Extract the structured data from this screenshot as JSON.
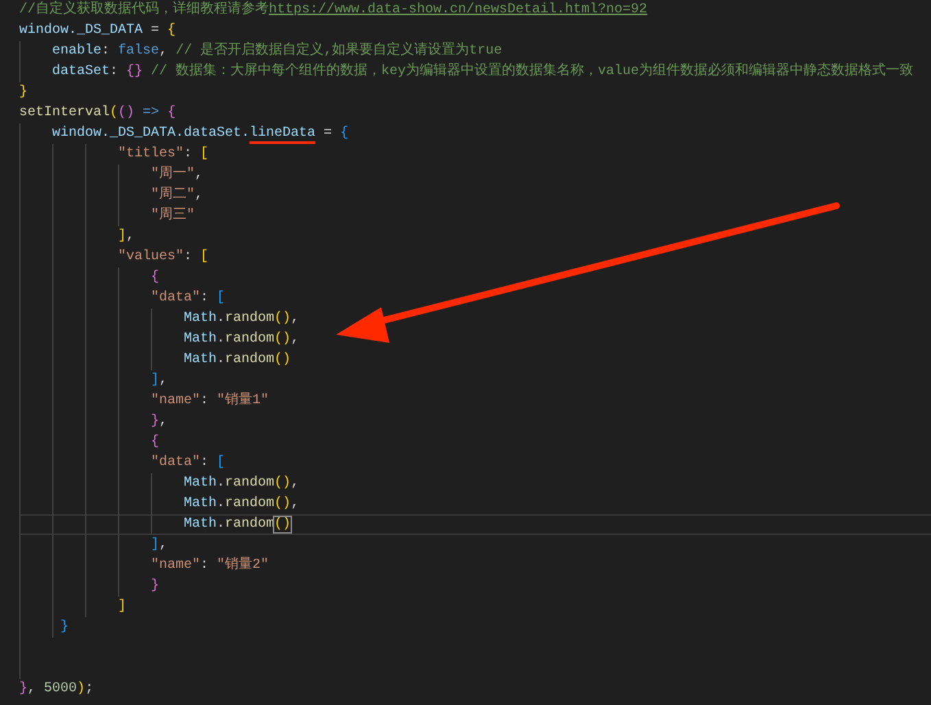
{
  "lines": [
    {
      "kind": "code",
      "tokens": [
        {
          "text": "//自定义获取数据代码，详细教程请参考",
          "kind": "comment"
        },
        {
          "text": "https://www.data-show.cn/newsDetail.html?no=92",
          "kind": "link"
        }
      ]
    },
    {
      "kind": "code",
      "tokens": [
        {
          "text": "window._DS_DATA",
          "kind": "variable"
        },
        {
          "text": " = ",
          "kind": "punct"
        },
        {
          "text": "{",
          "kind": "bracket1"
        }
      ]
    },
    {
      "kind": "code",
      "tokens": [
        {
          "text": "    enable",
          "kind": "variable"
        },
        {
          "text": ": ",
          "kind": "punct"
        },
        {
          "text": "false",
          "kind": "keyword"
        },
        {
          "text": ", ",
          "kind": "punct"
        },
        {
          "text": "// 是否开启数据自定义,如果要自定义请设置为true",
          "kind": "comment"
        }
      ]
    },
    {
      "kind": "code",
      "tokens": [
        {
          "text": "    dataSet",
          "kind": "variable"
        },
        {
          "text": ": ",
          "kind": "punct"
        },
        {
          "text": "{}",
          "kind": "bracket2"
        },
        {
          "text": " // 数据集：大屏中每个组件的数据，key为编辑器中设置的数据集名称，value为组件数据必须和编辑器中静态数据格式一致",
          "kind": "comment"
        }
      ]
    },
    {
      "kind": "code",
      "tokens": [
        {
          "text": "}",
          "kind": "bracket1"
        }
      ]
    },
    {
      "kind": "code",
      "tokens": [
        {
          "text": "setInterval",
          "kind": "function"
        },
        {
          "text": "(",
          "kind": "bracket1"
        },
        {
          "text": "()",
          "kind": "bracket2"
        },
        {
          "text": " => ",
          "kind": "keyword"
        },
        {
          "text": "{",
          "kind": "bracket2"
        }
      ]
    },
    {
      "kind": "code",
      "tokens": [
        {
          "text": "    window._DS_DATA.dataSet.",
          "kind": "variable"
        },
        {
          "text": "lineData",
          "kind": "variable",
          "underlined": true
        },
        {
          "text": " = ",
          "kind": "punct"
        },
        {
          "text": "{",
          "kind": "bracket3"
        }
      ]
    },
    {
      "kind": "code",
      "tokens": [
        {
          "text": "            \"titles\"",
          "kind": "string"
        },
        {
          "text": ": ",
          "kind": "punct"
        },
        {
          "text": "[",
          "kind": "bracket1"
        }
      ]
    },
    {
      "kind": "code",
      "tokens": [
        {
          "text": "                \"周一\"",
          "kind": "string"
        },
        {
          "text": ",",
          "kind": "punct"
        }
      ]
    },
    {
      "kind": "code",
      "tokens": [
        {
          "text": "                \"周二\"",
          "kind": "string"
        },
        {
          "text": ",",
          "kind": "punct"
        }
      ]
    },
    {
      "kind": "code",
      "tokens": [
        {
          "text": "                \"周三\"",
          "kind": "string"
        }
      ]
    },
    {
      "kind": "code",
      "tokens": [
        {
          "text": "            ]",
          "kind": "bracket1"
        },
        {
          "text": ",",
          "kind": "punct"
        }
      ]
    },
    {
      "kind": "code",
      "tokens": [
        {
          "text": "            \"values\"",
          "kind": "string"
        },
        {
          "text": ": ",
          "kind": "punct"
        },
        {
          "text": "[",
          "kind": "bracket1"
        }
      ]
    },
    {
      "kind": "code",
      "tokens": [
        {
          "text": "                {",
          "kind": "bracket2"
        }
      ]
    },
    {
      "kind": "code",
      "tokens": [
        {
          "text": "                \"data\"",
          "kind": "string"
        },
        {
          "text": ": ",
          "kind": "punct"
        },
        {
          "text": "[",
          "kind": "bracket3"
        }
      ]
    },
    {
      "kind": "code",
      "tokens": [
        {
          "text": "                    Math",
          "kind": "variable"
        },
        {
          "text": ".",
          "kind": "punct"
        },
        {
          "text": "random",
          "kind": "function"
        },
        {
          "text": "()",
          "kind": "bracket1"
        },
        {
          "text": ",",
          "kind": "punct"
        }
      ]
    },
    {
      "kind": "code",
      "tokens": [
        {
          "text": "                    Math",
          "kind": "variable"
        },
        {
          "text": ".",
          "kind": "punct"
        },
        {
          "text": "random",
          "kind": "function"
        },
        {
          "text": "()",
          "kind": "bracket1"
        },
        {
          "text": ",",
          "kind": "punct"
        }
      ]
    },
    {
      "kind": "code",
      "tokens": [
        {
          "text": "                    Math",
          "kind": "variable"
        },
        {
          "text": ".",
          "kind": "punct"
        },
        {
          "text": "random",
          "kind": "function"
        },
        {
          "text": "()",
          "kind": "bracket1"
        }
      ]
    },
    {
      "kind": "code",
      "tokens": [
        {
          "text": "                ]",
          "kind": "bracket3"
        },
        {
          "text": ",",
          "kind": "punct"
        }
      ]
    },
    {
      "kind": "code",
      "tokens": [
        {
          "text": "                \"name\"",
          "kind": "string"
        },
        {
          "text": ": ",
          "kind": "punct"
        },
        {
          "text": "\"销量1\"",
          "kind": "string"
        }
      ]
    },
    {
      "kind": "code",
      "tokens": [
        {
          "text": "                }",
          "kind": "bracket2"
        },
        {
          "text": ",",
          "kind": "punct"
        }
      ]
    },
    {
      "kind": "code",
      "tokens": [
        {
          "text": "                {",
          "kind": "bracket2"
        }
      ]
    },
    {
      "kind": "code",
      "tokens": [
        {
          "text": "                \"data\"",
          "kind": "string"
        },
        {
          "text": ": ",
          "kind": "punct"
        },
        {
          "text": "[",
          "kind": "bracket3"
        }
      ]
    },
    {
      "kind": "code",
      "tokens": [
        {
          "text": "                    Math",
          "kind": "variable"
        },
        {
          "text": ".",
          "kind": "punct"
        },
        {
          "text": "random",
          "kind": "function"
        },
        {
          "text": "()",
          "kind": "bracket1"
        },
        {
          "text": ",",
          "kind": "punct"
        }
      ]
    },
    {
      "kind": "code",
      "tokens": [
        {
          "text": "                    Math",
          "kind": "variable"
        },
        {
          "text": ".",
          "kind": "punct"
        },
        {
          "text": "random",
          "kind": "function"
        },
        {
          "text": "()",
          "kind": "bracket1"
        },
        {
          "text": ",",
          "kind": "punct"
        }
      ]
    },
    {
      "kind": "code",
      "current": true,
      "tokens": [
        {
          "text": "                    Math",
          "kind": "variable"
        },
        {
          "text": ".",
          "kind": "punct"
        },
        {
          "text": "random",
          "kind": "function"
        },
        {
          "text": "()",
          "kind": "bracket1",
          "matched": true
        }
      ]
    },
    {
      "kind": "code",
      "tokens": [
        {
          "text": "                ]",
          "kind": "bracket3"
        },
        {
          "text": ",",
          "kind": "punct"
        }
      ]
    },
    {
      "kind": "code",
      "tokens": [
        {
          "text": "                \"name\"",
          "kind": "string"
        },
        {
          "text": ": ",
          "kind": "punct"
        },
        {
          "text": "\"销量2\"",
          "kind": "string"
        }
      ]
    },
    {
      "kind": "code",
      "tokens": [
        {
          "text": "                }",
          "kind": "bracket2"
        }
      ]
    },
    {
      "kind": "code",
      "tokens": [
        {
          "text": "            ]",
          "kind": "bracket1"
        }
      ]
    },
    {
      "kind": "code",
      "tokens": [
        {
          "text": "     }",
          "kind": "bracket3"
        }
      ]
    },
    {
      "kind": "blank"
    },
    {
      "kind": "blank"
    },
    {
      "kind": "code",
      "tokens": [
        {
          "text": "}",
          "kind": "bracket2"
        },
        {
          "text": ", ",
          "kind": "punct"
        },
        {
          "text": "5000",
          "kind": "number"
        },
        {
          "text": ")",
          "kind": "bracket1"
        },
        {
          "text": ";",
          "kind": "punct"
        }
      ]
    }
  ]
}
